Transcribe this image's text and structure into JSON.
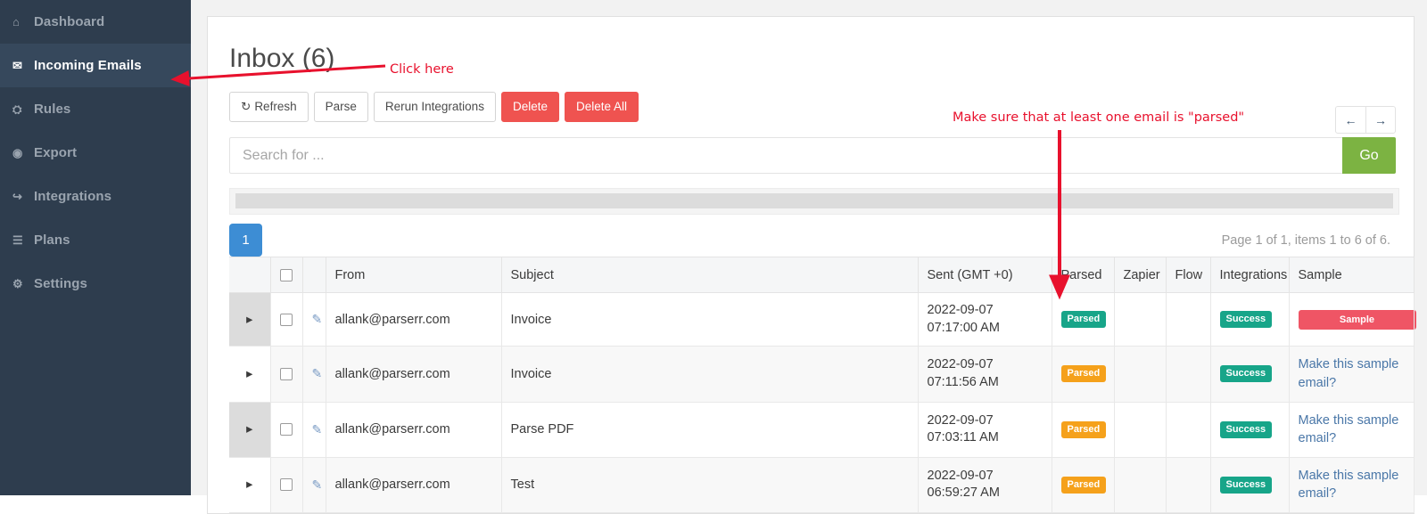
{
  "sidebar": {
    "items": [
      {
        "label": "Dashboard",
        "icon": "home-icon",
        "glyph": "⌂",
        "active": false
      },
      {
        "label": "Incoming Emails",
        "icon": "envelope-icon",
        "glyph": "✉",
        "active": true
      },
      {
        "label": "Rules",
        "icon": "sitemap-icon",
        "glyph": "⛭",
        "active": false
      },
      {
        "label": "Export",
        "icon": "circle-dot-icon",
        "glyph": "◉",
        "active": false
      },
      {
        "label": "Integrations",
        "icon": "share-arrow-icon",
        "glyph": "↪",
        "active": false
      },
      {
        "label": "Plans",
        "icon": "credit-card-icon",
        "glyph": "☰",
        "active": false
      },
      {
        "label": "Settings",
        "icon": "gear-icon",
        "glyph": "⚙",
        "active": false
      }
    ]
  },
  "page": {
    "title": "Inbox (6)"
  },
  "toolbar": {
    "refresh_label": "Refresh",
    "refresh_glyph": "↻",
    "parse_label": "Parse",
    "rerun_label": "Rerun Integrations",
    "delete_label": "Delete",
    "delete_all_label": "Delete All",
    "prev_glyph": "←",
    "next_glyph": "→"
  },
  "search": {
    "value": "",
    "placeholder": "Search for ...",
    "go_label": "Go"
  },
  "pager": {
    "page_number": "1",
    "info": "Page 1 of 1, items 1 to 6 of 6."
  },
  "table": {
    "headers": {
      "expand": "",
      "checkbox": "",
      "clip": "",
      "from": "From",
      "subject": "Subject",
      "sent": "Sent (GMT +0)",
      "parsed": "Parsed",
      "zapier": "Zapier",
      "flow": "Flow",
      "integrations": "Integrations",
      "sample": "Sample"
    },
    "expand_glyph": "▸",
    "clip_glyph": "✎",
    "rows": [
      {
        "from": "allank@parserr.com",
        "subject": "Invoice",
        "sent_date": "2022-09-07",
        "sent_time": "07:17:00 AM",
        "parsed": "Parsed",
        "parsed_style": "teal",
        "zapier": "",
        "flow": "",
        "integrations": "Success",
        "sample_badge": "Sample",
        "sample_link": ""
      },
      {
        "from": "allank@parserr.com",
        "subject": "Invoice",
        "sent_date": "2022-09-07",
        "sent_time": "07:11:56 AM",
        "parsed": "Parsed",
        "parsed_style": "orange",
        "zapier": "",
        "flow": "",
        "integrations": "Success",
        "sample_badge": "",
        "sample_link": "Make this sample email?"
      },
      {
        "from": "allank@parserr.com",
        "subject": "Parse PDF",
        "sent_date": "2022-09-07",
        "sent_time": "07:03:11 AM",
        "parsed": "Parsed",
        "parsed_style": "orange",
        "zapier": "",
        "flow": "",
        "integrations": "Success",
        "sample_badge": "",
        "sample_link": "Make this sample email?"
      },
      {
        "from": "allank@parserr.com",
        "subject": "Test",
        "sent_date": "2022-09-07",
        "sent_time": "06:59:27 AM",
        "parsed": "Parsed",
        "parsed_style": "orange",
        "zapier": "",
        "flow": "",
        "integrations": "Success",
        "sample_badge": "",
        "sample_link": "Make this sample email?"
      }
    ]
  },
  "annotations": {
    "click_here": "Click here",
    "parsed_note": "Make sure that at least one email is \"parsed\"",
    "color": "#e8112d"
  }
}
